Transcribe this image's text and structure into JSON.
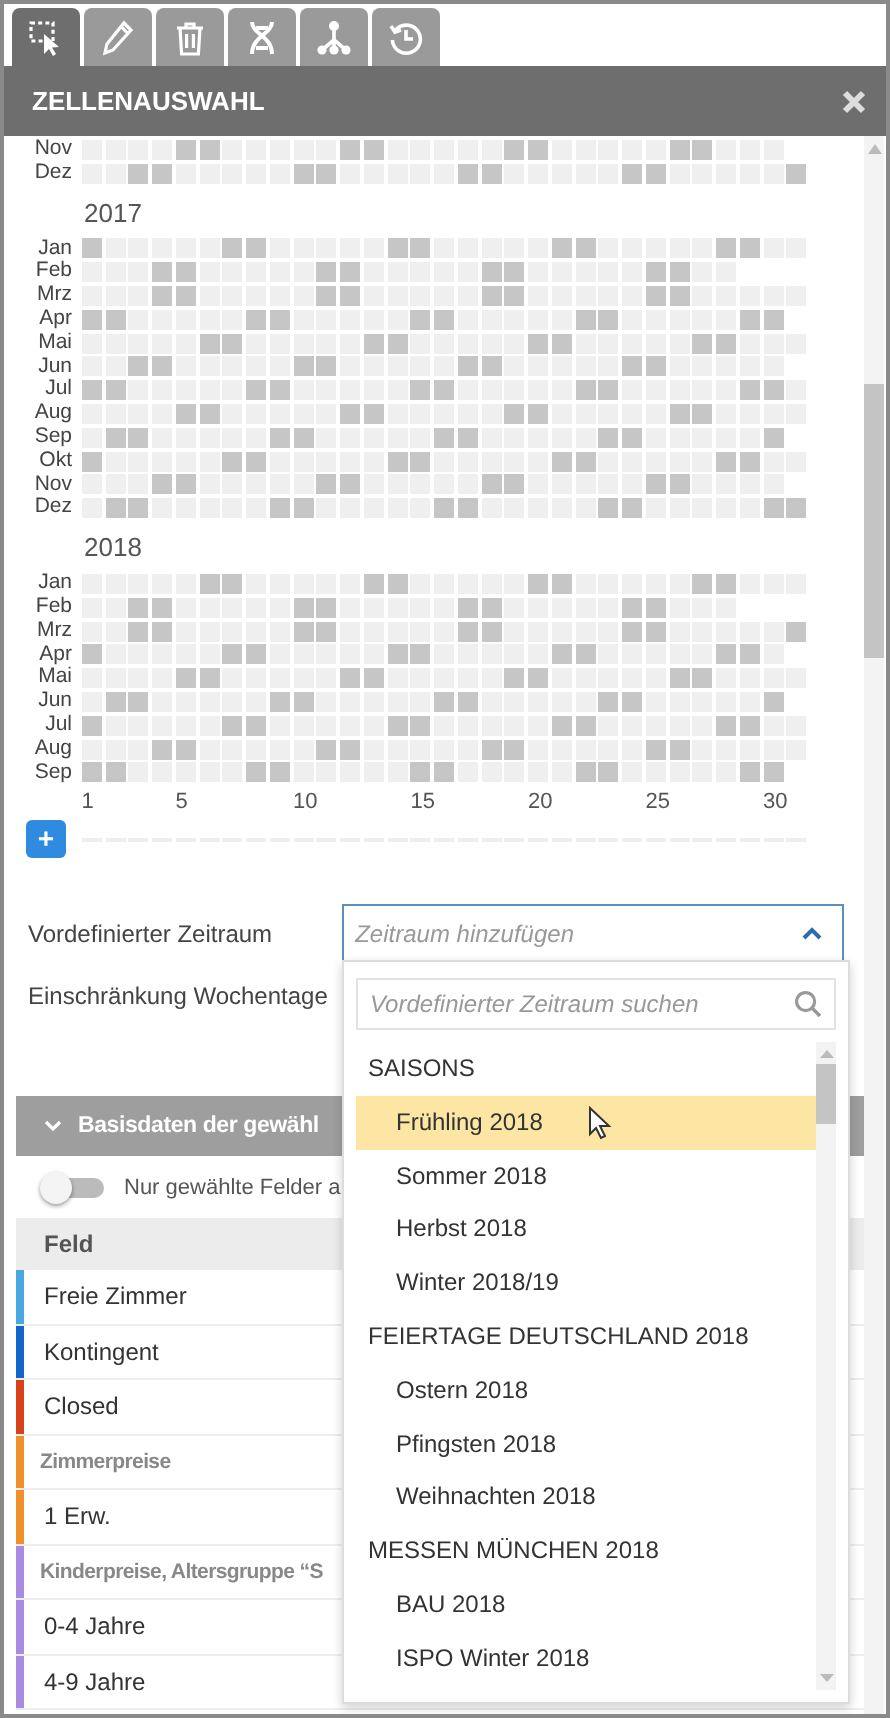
{
  "tabs": [
    {
      "kind": "select",
      "selected": true
    },
    {
      "kind": "pencil",
      "selected": false
    },
    {
      "kind": "trash",
      "selected": false
    },
    {
      "kind": "helix",
      "selected": false
    },
    {
      "kind": "hierarchy",
      "selected": false
    },
    {
      "kind": "history",
      "selected": false
    }
  ],
  "panel": {
    "title": "ZELLENAUSWAHL"
  },
  "calendar": {
    "years": [
      {
        "months": [
          {
            "name": "Nov",
            "weekend": [
              false,
              false,
              false,
              false,
              true,
              true,
              false,
              false,
              false,
              false,
              false,
              true,
              true,
              false,
              false,
              false,
              false,
              false,
              true,
              true,
              false,
              false,
              false,
              false,
              false,
              true,
              true,
              false,
              false,
              false
            ]
          },
          {
            "name": "Dez",
            "weekend": [
              false,
              false,
              true,
              true,
              false,
              false,
              false,
              false,
              false,
              true,
              true,
              false,
              false,
              false,
              false,
              false,
              true,
              true,
              false,
              false,
              false,
              false,
              false,
              true,
              true,
              false,
              false,
              false,
              false,
              false,
              true
            ]
          }
        ]
      },
      {
        "year": "2017",
        "months": [
          {
            "name": "Jan",
            "weekend": [
              true,
              false,
              false,
              false,
              false,
              false,
              true,
              true,
              false,
              false,
              false,
              false,
              false,
              true,
              true,
              false,
              false,
              false,
              false,
              false,
              true,
              true,
              false,
              false,
              false,
              false,
              false,
              true,
              true,
              false,
              false
            ]
          },
          {
            "name": "Feb",
            "weekend": [
              false,
              false,
              false,
              true,
              true,
              false,
              false,
              false,
              false,
              false,
              true,
              true,
              false,
              false,
              false,
              false,
              false,
              true,
              true,
              false,
              false,
              false,
              false,
              false,
              true,
              true,
              false,
              false
            ]
          },
          {
            "name": "Mrz",
            "weekend": [
              false,
              false,
              false,
              true,
              true,
              false,
              false,
              false,
              false,
              false,
              true,
              true,
              false,
              false,
              false,
              false,
              false,
              true,
              true,
              false,
              false,
              false,
              false,
              false,
              true,
              true,
              false,
              false,
              false,
              false,
              false
            ]
          },
          {
            "name": "Apr",
            "weekend": [
              true,
              true,
              false,
              false,
              false,
              false,
              false,
              true,
              true,
              false,
              false,
              false,
              false,
              false,
              true,
              true,
              false,
              false,
              false,
              false,
              false,
              true,
              true,
              false,
              false,
              false,
              false,
              false,
              true,
              true
            ]
          },
          {
            "name": "Mai",
            "weekend": [
              false,
              false,
              false,
              false,
              false,
              true,
              true,
              false,
              false,
              false,
              false,
              false,
              true,
              true,
              false,
              false,
              false,
              false,
              false,
              true,
              true,
              false,
              false,
              false,
              false,
              false,
              true,
              true,
              false,
              false,
              false
            ]
          },
          {
            "name": "Jun",
            "weekend": [
              false,
              false,
              true,
              true,
              false,
              false,
              false,
              false,
              false,
              true,
              true,
              false,
              false,
              false,
              false,
              false,
              true,
              true,
              false,
              false,
              false,
              false,
              false,
              true,
              true,
              false,
              false,
              false,
              false,
              false
            ]
          },
          {
            "name": "Jul",
            "weekend": [
              true,
              true,
              false,
              false,
              false,
              false,
              false,
              true,
              true,
              false,
              false,
              false,
              false,
              false,
              true,
              true,
              false,
              false,
              false,
              false,
              false,
              true,
              true,
              false,
              false,
              false,
              false,
              false,
              true,
              true,
              false
            ]
          },
          {
            "name": "Aug",
            "weekend": [
              false,
              false,
              false,
              false,
              true,
              true,
              false,
              false,
              false,
              false,
              false,
              true,
              true,
              false,
              false,
              false,
              false,
              false,
              true,
              true,
              false,
              false,
              false,
              false,
              false,
              true,
              true,
              false,
              false,
              false,
              false
            ]
          },
          {
            "name": "Sep",
            "weekend": [
              false,
              true,
              true,
              false,
              false,
              false,
              false,
              false,
              true,
              true,
              false,
              false,
              false,
              false,
              false,
              true,
              true,
              false,
              false,
              false,
              false,
              false,
              true,
              true,
              false,
              false,
              false,
              false,
              false,
              true
            ]
          },
          {
            "name": "Okt",
            "weekend": [
              true,
              false,
              false,
              false,
              false,
              false,
              true,
              true,
              false,
              false,
              false,
              false,
              false,
              true,
              true,
              false,
              false,
              false,
              false,
              false,
              true,
              true,
              false,
              false,
              false,
              false,
              false,
              true,
              true,
              false,
              false
            ]
          },
          {
            "name": "Nov",
            "weekend": [
              false,
              false,
              false,
              true,
              true,
              false,
              false,
              false,
              false,
              false,
              true,
              true,
              false,
              false,
              false,
              false,
              false,
              true,
              true,
              false,
              false,
              false,
              false,
              false,
              true,
              true,
              false,
              false,
              false,
              false
            ]
          },
          {
            "name": "Dez",
            "weekend": [
              false,
              true,
              true,
              false,
              false,
              false,
              false,
              false,
              true,
              true,
              false,
              false,
              false,
              false,
              false,
              true,
              true,
              false,
              false,
              false,
              false,
              false,
              true,
              true,
              false,
              false,
              false,
              false,
              false,
              true,
              true
            ]
          }
        ]
      },
      {
        "year": "2018",
        "months": [
          {
            "name": "Jan",
            "weekend": [
              false,
              false,
              false,
              false,
              false,
              true,
              true,
              false,
              false,
              false,
              false,
              false,
              true,
              true,
              false,
              false,
              false,
              false,
              false,
              true,
              true,
              false,
              false,
              false,
              false,
              false,
              true,
              true,
              false,
              false,
              false
            ]
          },
          {
            "name": "Feb",
            "weekend": [
              false,
              false,
              true,
              true,
              false,
              false,
              false,
              false,
              false,
              true,
              true,
              false,
              false,
              false,
              false,
              false,
              true,
              true,
              false,
              false,
              false,
              false,
              false,
              true,
              true,
              false,
              false,
              false
            ]
          },
          {
            "name": "Mrz",
            "weekend": [
              false,
              false,
              true,
              true,
              false,
              false,
              false,
              false,
              false,
              true,
              true,
              false,
              false,
              false,
              false,
              false,
              true,
              true,
              false,
              false,
              false,
              false,
              false,
              true,
              true,
              false,
              false,
              false,
              false,
              false,
              true
            ]
          },
          {
            "name": "Apr",
            "weekend": [
              true,
              false,
              false,
              false,
              false,
              false,
              true,
              true,
              false,
              false,
              false,
              false,
              false,
              true,
              true,
              false,
              false,
              false,
              false,
              false,
              true,
              true,
              false,
              false,
              false,
              false,
              false,
              true,
              true,
              false
            ]
          },
          {
            "name": "Mai",
            "weekend": [
              false,
              false,
              false,
              false,
              true,
              true,
              false,
              false,
              false,
              false,
              false,
              true,
              true,
              false,
              false,
              false,
              false,
              false,
              true,
              true,
              false,
              false,
              false,
              false,
              false,
              true,
              true,
              false,
              false,
              false,
              false
            ]
          },
          {
            "name": "Jun",
            "weekend": [
              false,
              true,
              true,
              false,
              false,
              false,
              false,
              false,
              true,
              true,
              false,
              false,
              false,
              false,
              false,
              true,
              true,
              false,
              false,
              false,
              false,
              false,
              true,
              true,
              false,
              false,
              false,
              false,
              false,
              true
            ]
          },
          {
            "name": "Jul",
            "weekend": [
              true,
              false,
              false,
              false,
              false,
              false,
              true,
              true,
              false,
              false,
              false,
              false,
              false,
              true,
              true,
              false,
              false,
              false,
              false,
              false,
              true,
              true,
              false,
              false,
              false,
              false,
              false,
              true,
              true,
              false,
              false
            ]
          },
          {
            "name": "Aug",
            "weekend": [
              false,
              false,
              false,
              true,
              true,
              false,
              false,
              false,
              false,
              false,
              true,
              true,
              false,
              false,
              false,
              false,
              false,
              true,
              true,
              false,
              false,
              false,
              false,
              false,
              true,
              true,
              false,
              false,
              false,
              false,
              false
            ]
          },
          {
            "name": "Sep",
            "weekend": [
              true,
              true,
              false,
              false,
              false,
              false,
              false,
              true,
              true,
              false,
              false,
              false,
              false,
              false,
              true,
              true,
              false,
              false,
              false,
              false,
              false,
              true,
              true,
              false,
              false,
              false,
              false,
              false,
              true,
              true
            ]
          }
        ]
      }
    ],
    "day_ticks": [
      {
        "label": "1"
      },
      {
        "label": "5"
      },
      {
        "label": "10"
      },
      {
        "label": "15"
      },
      {
        "label": "20"
      },
      {
        "label": "25"
      },
      {
        "label": "30"
      }
    ],
    "add_button": "+"
  },
  "form": {
    "period_label": "Vordefinierter Zeitraum",
    "period_placeholder": "Zeitraum hinzufügen",
    "weekday_label": "Einschränkung Wochentage"
  },
  "dropdown": {
    "search_placeholder": "Vordefinierter Zeitraum suchen",
    "items": [
      {
        "kind": "group",
        "label": "SAISONS"
      },
      {
        "kind": "option",
        "label": "Frühling 2018",
        "selected": true
      },
      {
        "kind": "option",
        "label": "Sommer 2018",
        "selected": false
      },
      {
        "kind": "option",
        "label": "Herbst 2018",
        "selected": false
      },
      {
        "kind": "option",
        "label": "Winter 2018/19",
        "selected": false
      },
      {
        "kind": "group",
        "label": "FEIERTAGE DEUTSCHLAND 2018"
      },
      {
        "kind": "option",
        "label": "Ostern 2018",
        "selected": false
      },
      {
        "kind": "option",
        "label": "Pfingsten 2018",
        "selected": false
      },
      {
        "kind": "option",
        "label": "Weihnachten 2018",
        "selected": false
      },
      {
        "kind": "group",
        "label": "MESSEN MÜNCHEN 2018"
      },
      {
        "kind": "option",
        "label": "BAU 2018",
        "selected": false
      },
      {
        "kind": "option",
        "label": "ISPO Winter 2018",
        "selected": false
      }
    ]
  },
  "section": {
    "title": "Basisdaten der gewähl",
    "toggle": {
      "label": "Nur gewählte Felder a",
      "on": false
    },
    "column": "Feld",
    "rows": [
      {
        "kind": "field",
        "label": "Freie Zimmer",
        "color": "#4aa8e0"
      },
      {
        "kind": "field",
        "label": "Kontingent",
        "color": "#1565c8"
      },
      {
        "kind": "field",
        "label": "Closed",
        "color": "#d8421a"
      },
      {
        "kind": "group",
        "label": "Zimmerpreise",
        "color": "#f0902a"
      },
      {
        "kind": "field",
        "label": "1 Erw.",
        "color": "#f0902a"
      },
      {
        "kind": "group",
        "label": "Kinderpreise, Altersgruppe “S",
        "color": "#a98be2"
      },
      {
        "kind": "field",
        "label": "0-4 Jahre",
        "color": "#a98be2"
      },
      {
        "kind": "field",
        "label": "4-9 Jahre",
        "color": "#a98be2"
      }
    ]
  }
}
